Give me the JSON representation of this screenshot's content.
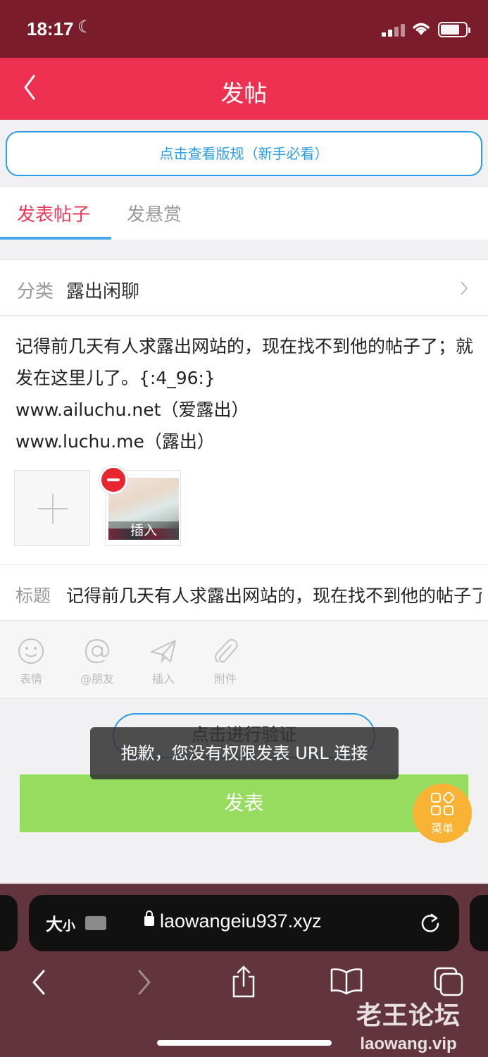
{
  "status_bar": {
    "time": "18:17"
  },
  "header": {
    "title": "发帖"
  },
  "rules_button": "点击查看版规（新手必看）",
  "tabs": [
    {
      "label": "发表帖子",
      "active": true
    },
    {
      "label": "发悬赏",
      "active": false
    }
  ],
  "category": {
    "label": "分类",
    "value": "露出闲聊"
  },
  "content": {
    "lines": [
      "记得前几天有人求露出网站的，现在找不到他的帖子了；就发在这里儿了。{:4_96:}",
      "www.ailuchu.net（爱露出）",
      "www.luchu.me（露出）"
    ],
    "attachment_insert_label": "插入"
  },
  "title_field": {
    "label": "标题",
    "value": "记得前几天有人求露出网站的，现在找不到他的帖子了"
  },
  "toolbar": [
    {
      "icon": "smiley-icon",
      "label": "表情"
    },
    {
      "icon": "at-icon",
      "label": "@朋友"
    },
    {
      "icon": "send-icon",
      "label": "插入"
    },
    {
      "icon": "paperclip-icon",
      "label": "附件"
    }
  ],
  "verify_button": "点击进行验证",
  "submit_button": "发表",
  "toast": "抱歉，您没有权限发表 URL 连接",
  "menu_fab": {
    "label": "菜单"
  },
  "browser": {
    "text_size_label": "大",
    "text_size_small": "小",
    "url": "laowangeiu937.xyz"
  },
  "watermark": {
    "cn": "老王论坛",
    "en": "laowang.vip"
  },
  "colors": {
    "status_bar": "#7a1c2a",
    "header": "#ef3151",
    "accent_blue": "#2a9be6",
    "tab_active": "#ee3a57",
    "submit": "#96dc5f",
    "fab": "#f9b233"
  }
}
